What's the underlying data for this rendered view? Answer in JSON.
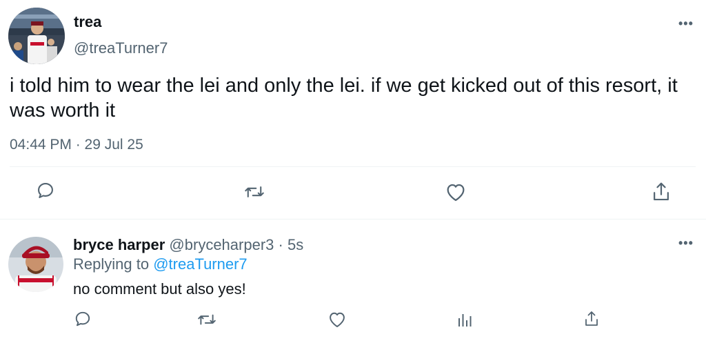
{
  "main_tweet": {
    "display_name": "trea",
    "handle": "@treaTurner7",
    "text": "i told him to wear the lei and only the lei. if we get kicked out of this resort, it was worth it",
    "timestamp": "04:44 PM · 29 Jul 25",
    "more_label": "•••",
    "actions": [
      "reply-icon",
      "retweet-icon",
      "like-icon",
      "share-icon"
    ]
  },
  "reply_tweet": {
    "display_name": "bryce harper",
    "handle": "@bryceharper3",
    "separator": "·",
    "time": "5s",
    "replying_prefix": "Replying to",
    "replying_to": "@treaTurner7",
    "text": "no comment but also yes!",
    "more_label": "•••",
    "actions": [
      "reply-icon",
      "retweet-icon",
      "like-icon",
      "analytics-icon",
      "share-icon"
    ]
  },
  "colors": {
    "text_primary": "#0f1419",
    "text_secondary": "#536471",
    "link": "#1d9bf0",
    "divider": "#eff3f4"
  }
}
